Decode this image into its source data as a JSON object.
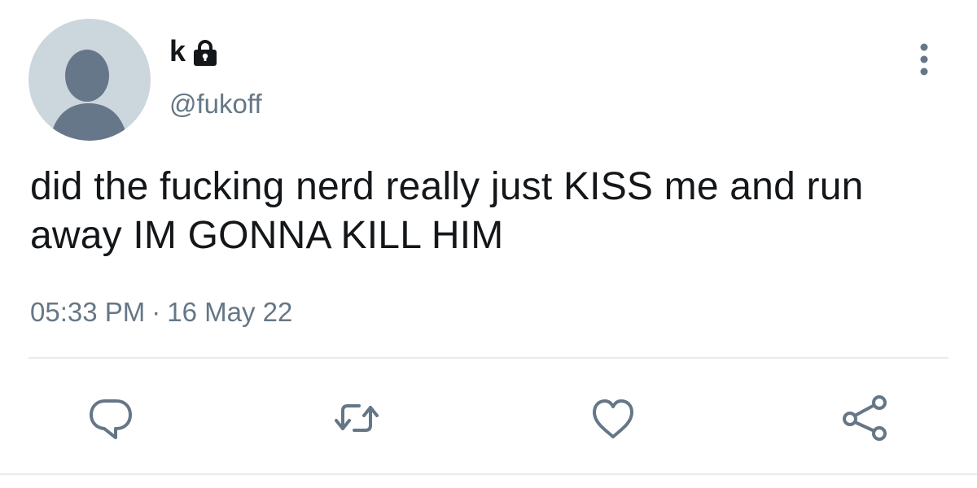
{
  "tweet": {
    "user": {
      "display_name": "k",
      "handle": "@fukoff",
      "protected_icon": "lock-icon",
      "avatar_icon": "default-profile-icon"
    },
    "text": "did the fucking nerd really just KISS me and run away IM GONNA KILL HIM",
    "time": "05:33 PM",
    "separator": "·",
    "date": "16 May 22",
    "more_icon": "vertical-ellipsis-icon",
    "actions": [
      {
        "name": "reply",
        "icon": "reply-icon"
      },
      {
        "name": "retweet",
        "icon": "retweet-icon"
      },
      {
        "name": "like",
        "icon": "heart-icon"
      },
      {
        "name": "share",
        "icon": "share-icon"
      }
    ]
  },
  "colors": {
    "text_primary": "#14171a",
    "text_secondary": "#657786",
    "avatar_bg": "#ccd6dd",
    "avatar_figure": "#66778a",
    "divider": "#e6ecf0"
  }
}
